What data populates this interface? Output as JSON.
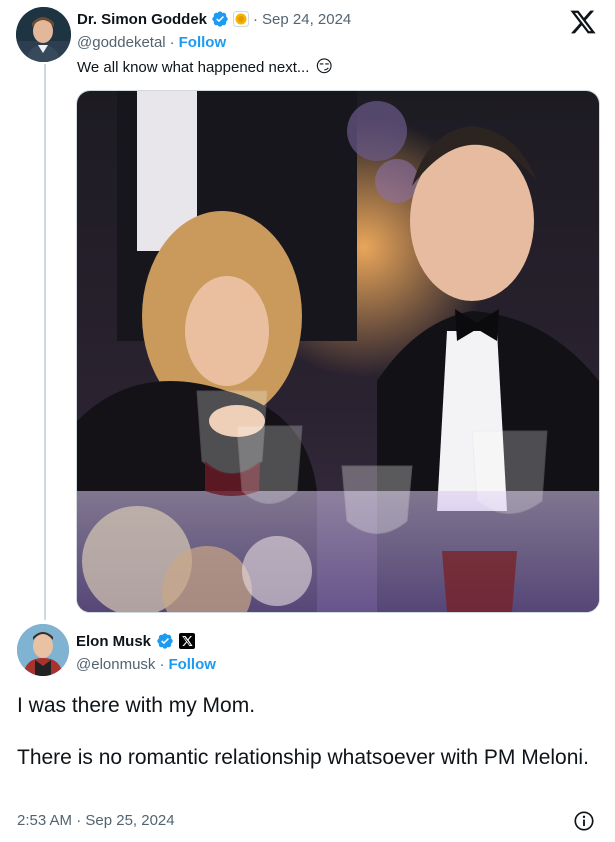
{
  "parent_tweet": {
    "display_name": "Dr. Simon Goddek",
    "handle": "@goddeketal",
    "separator": "·",
    "date": "Sep 24, 2024",
    "follow_label": "Follow",
    "text": "We all know what happened next...",
    "emoji": "😏",
    "image_description_colors": {
      "background": "#2a2230",
      "accent_purple": "#9a7bd6",
      "warm": "#d8824a"
    }
  },
  "reply_tweet": {
    "display_name": "Elon Musk",
    "handle": "@elonmusk",
    "separator": "·",
    "follow_label": "Follow",
    "body_paragraph_1": "I was there with my Mom.",
    "body_paragraph_2": "There is no romantic relationship whatsoever with PM Meloni.",
    "timestamp": "2:53 AM · Sep 25, 2024"
  },
  "colors": {
    "verified_blue": "#1d9bf0",
    "text_primary": "#0f1419",
    "text_secondary": "#536471",
    "thread_line": "#cfd9de"
  },
  "icons": {
    "x_logo": "x-logo-icon",
    "verified": "verified-badge-icon",
    "info": "info-icon"
  }
}
